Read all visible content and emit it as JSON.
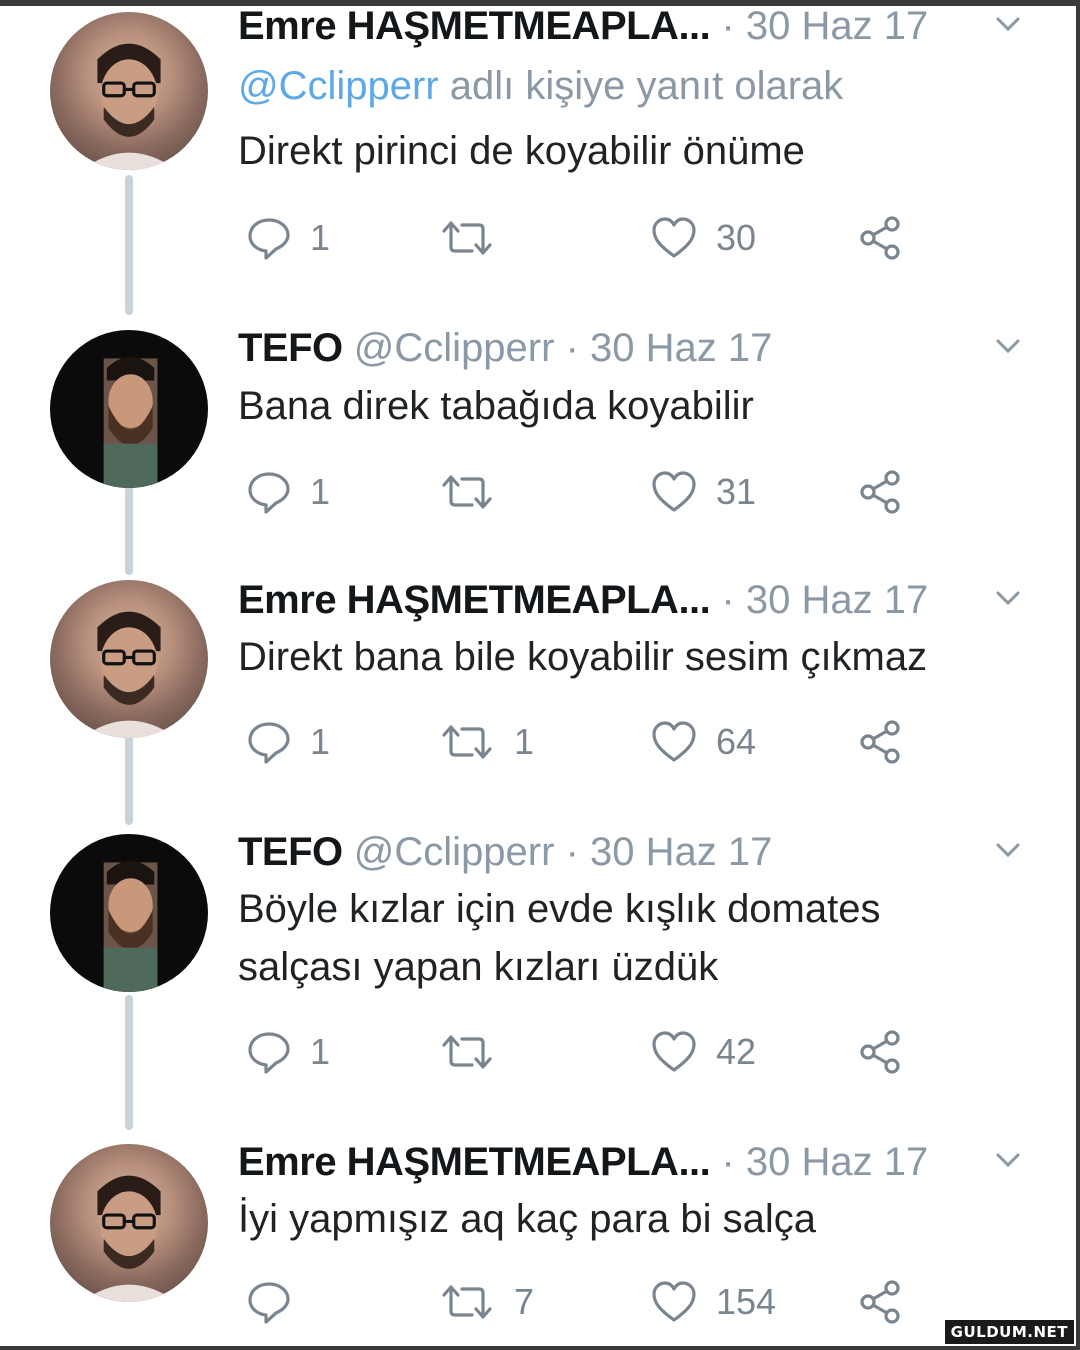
{
  "tweets": [
    {
      "author_type": "emre",
      "name": "Emre HAŞMETMEAPLA...",
      "handle": "",
      "separator": "·",
      "date": "30 Haz 17",
      "reply_prefix": "@Cclipperr",
      "reply_suffix": " adlı kişiye yanıt olarak",
      "lines": [
        "Direkt pirinci de koyabilir önüme"
      ],
      "replies": "1",
      "retweets": "",
      "likes": "30"
    },
    {
      "author_type": "tefo",
      "name": "TEFO",
      "handle": "@Cclipperr",
      "separator": "·",
      "date": "30 Haz 17",
      "lines": [
        "Bana direk tabağıda koyabilir"
      ],
      "replies": "1",
      "retweets": "",
      "likes": "31"
    },
    {
      "author_type": "emre",
      "name": "Emre HAŞMETMEAPLA...",
      "handle": "",
      "separator": "·",
      "date": "30 Haz 17",
      "lines": [
        "Direkt bana bile koyabilir sesim çıkmaz"
      ],
      "replies": "1",
      "retweets": "1",
      "likes": "64"
    },
    {
      "author_type": "tefo",
      "name": "TEFO",
      "handle": "@Cclipperr",
      "separator": "·",
      "date": "30 Haz 17",
      "lines": [
        "Böyle kızlar için evde kışlık domates",
        "salçası yapan kızları üzdük"
      ],
      "replies": "1",
      "retweets": "",
      "likes": "42"
    },
    {
      "author_type": "emre",
      "name": "Emre HAŞMETMEAPLA...",
      "handle": "",
      "separator": "·",
      "date": "30 Haz 17",
      "lines": [
        "İyi yapmışız aq kaç para bi salça"
      ],
      "replies": "",
      "retweets": "7",
      "likes": "154"
    }
  ],
  "watermark": "GULDUM.NET",
  "colors": {
    "name": "#14171a",
    "meta": "#8b98a5",
    "mention": "#5ea8e8",
    "icon": "#7a8590",
    "thread_line": "#c8d2da"
  },
  "icons": [
    "reply-icon",
    "retweet-icon",
    "like-icon",
    "share-icon",
    "chevron-down-icon"
  ]
}
